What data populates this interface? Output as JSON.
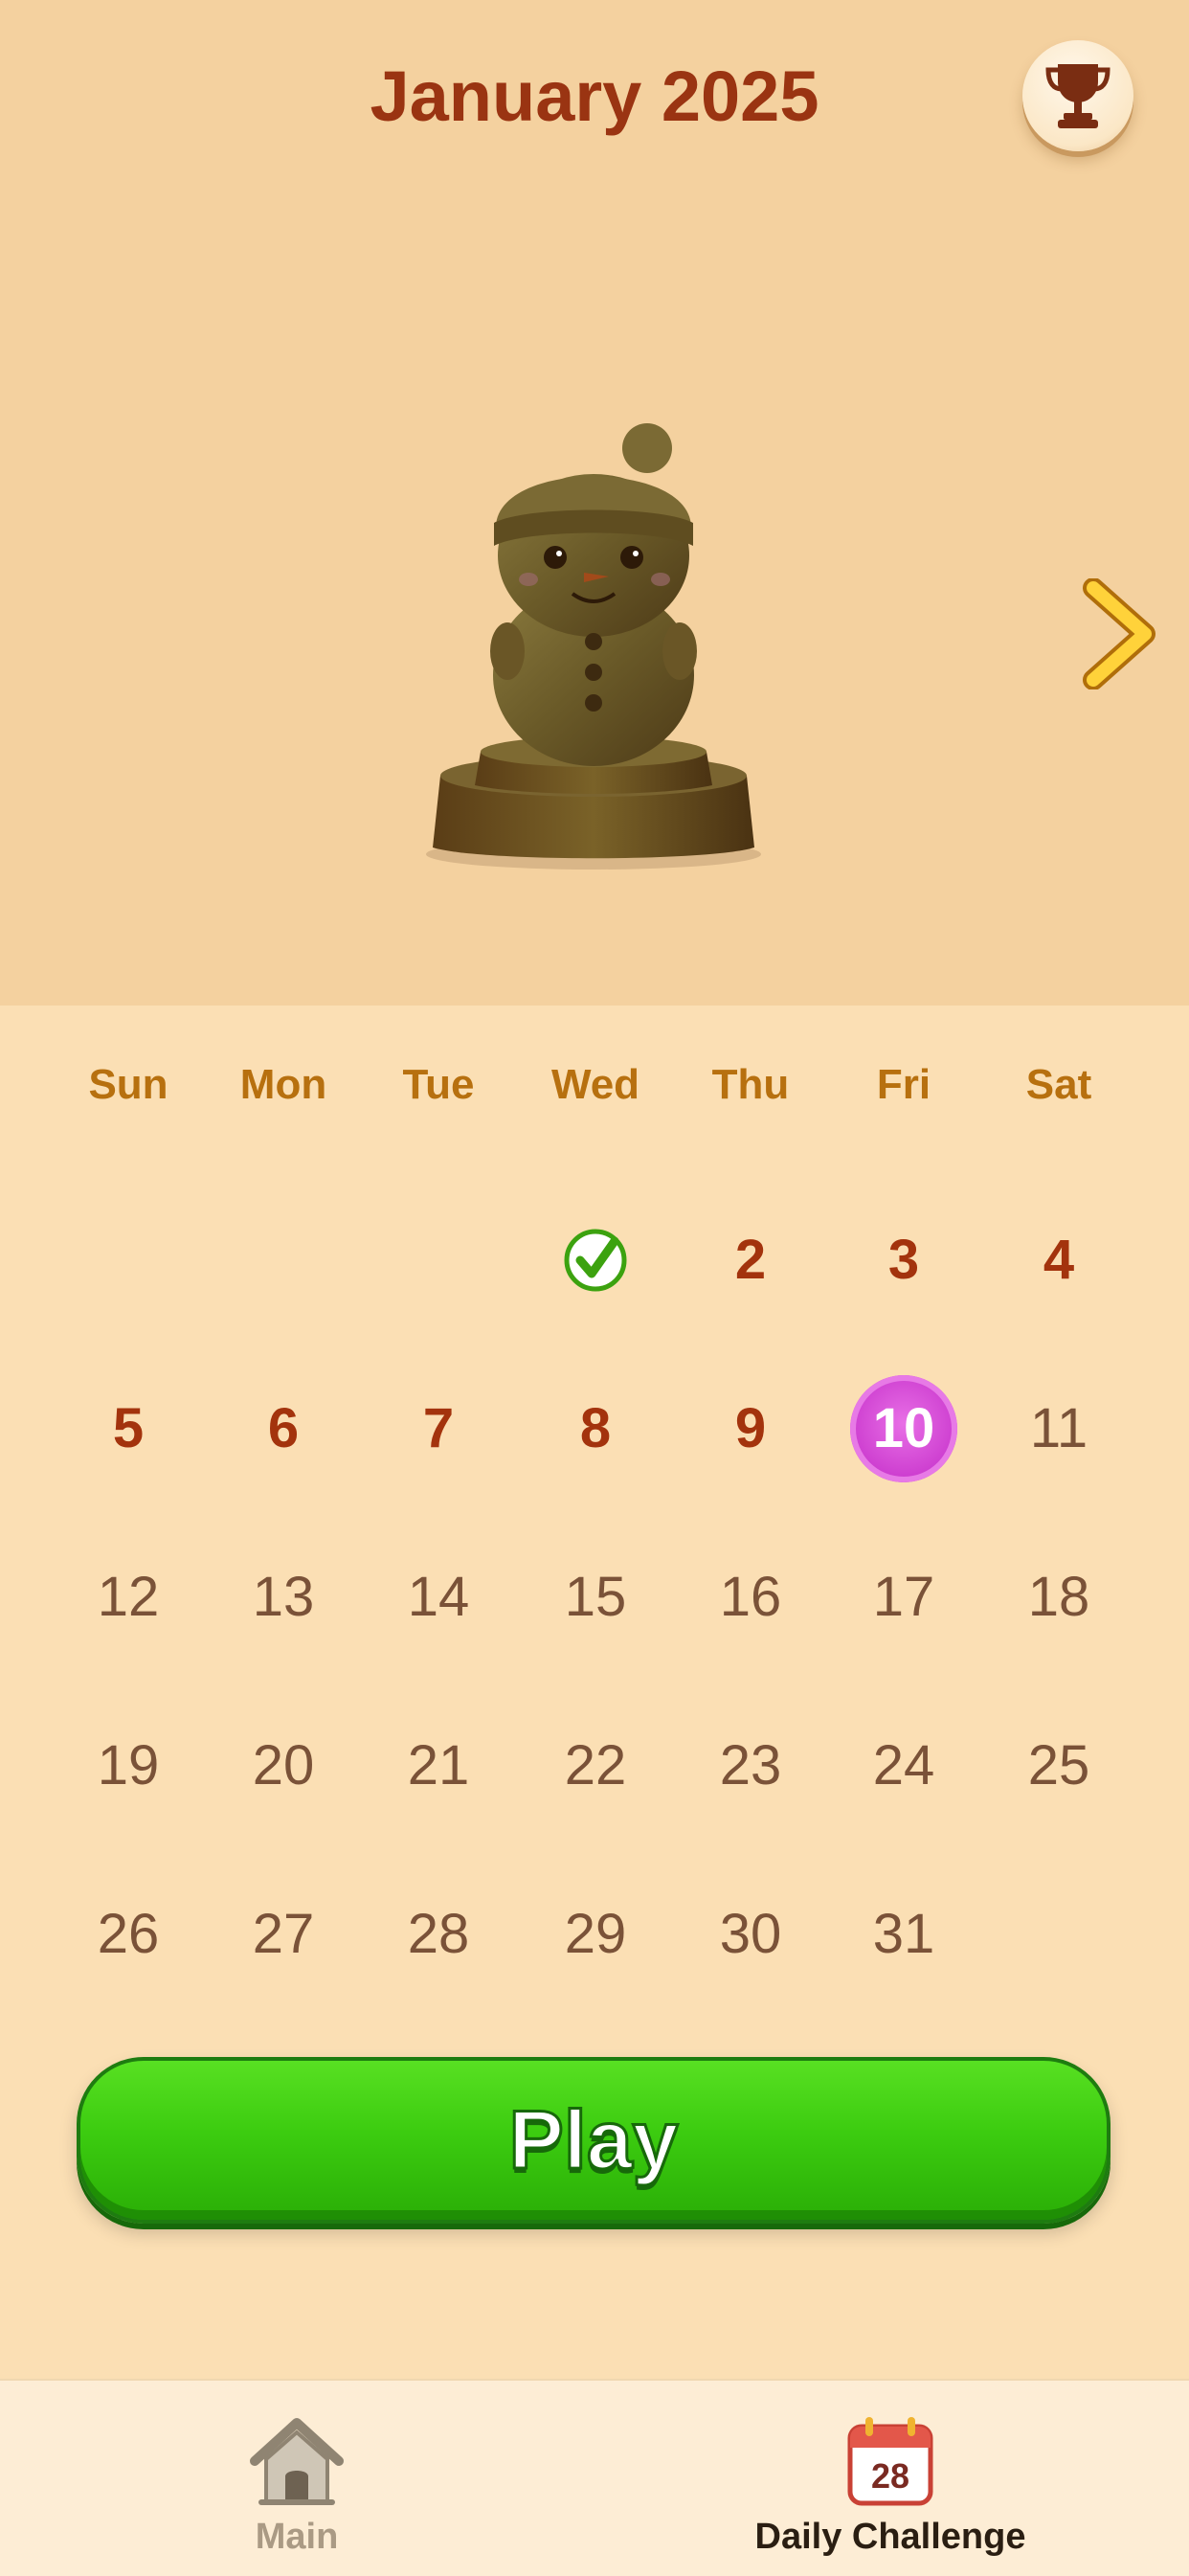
{
  "header": {
    "title": "January 2025",
    "trophy_icon": "trophy-icon"
  },
  "hero": {
    "trophy_art": "snowman-trophy-icon",
    "next_icon": "chevron-right-icon"
  },
  "calendar": {
    "weekdays": [
      "Sun",
      "Mon",
      "Tue",
      "Wed",
      "Thu",
      "Fri",
      "Sat"
    ],
    "completed_day": "1",
    "today": "10",
    "days": [
      "2",
      "3",
      "4",
      "5",
      "6",
      "7",
      "8",
      "9",
      "10",
      "11",
      "12",
      "13",
      "14",
      "15",
      "16",
      "17",
      "18",
      "19",
      "20",
      "21",
      "22",
      "23",
      "24",
      "25",
      "26",
      "27",
      "28",
      "29",
      "30",
      "31"
    ]
  },
  "play_button": {
    "label": "Play"
  },
  "nav": {
    "main": {
      "label": "Main",
      "icon": "house-icon"
    },
    "daily": {
      "label": "Daily Challenge",
      "icon": "calendar-icon",
      "badge": "28"
    }
  },
  "colors": {
    "title": "#9a3412",
    "weekday": "#b7700f",
    "past_day": "#a3330d",
    "future_day": "#7a5238",
    "today_circle": "#cc3ccf",
    "play_green": "#3ccc10"
  }
}
